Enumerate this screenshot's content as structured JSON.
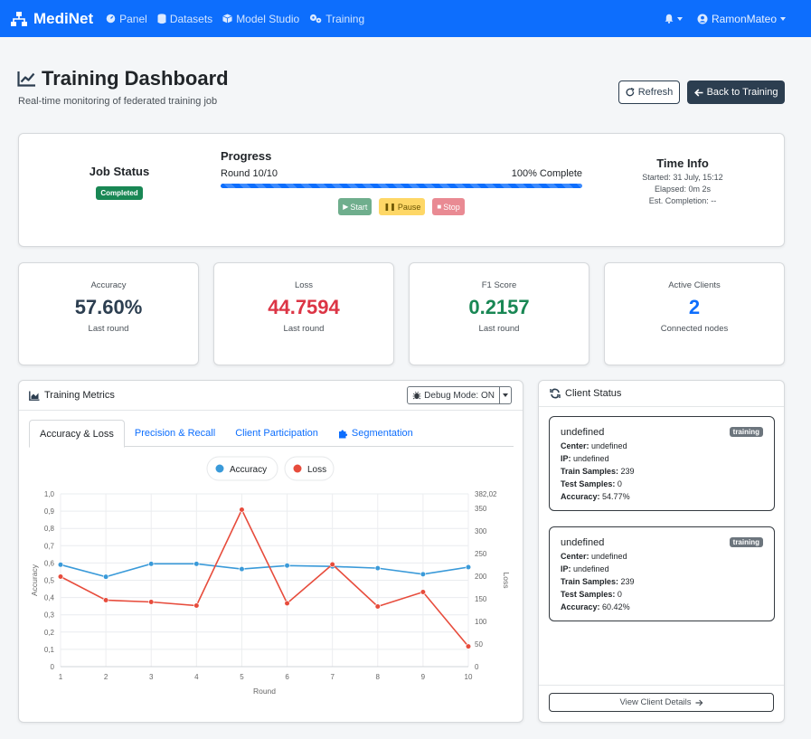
{
  "navbar": {
    "brand": "MediNet",
    "items": [
      {
        "label": "Panel",
        "icon": "dashboard-icon"
      },
      {
        "label": "Datasets",
        "icon": "database-icon"
      },
      {
        "label": "Model Studio",
        "icon": "cube-icon"
      },
      {
        "label": "Training",
        "icon": "gears-icon"
      }
    ],
    "user": "RamonMateo"
  },
  "header": {
    "title": "Training Dashboard",
    "subtitle": "Real-time monitoring of federated training job",
    "refresh_label": "Refresh",
    "back_label": "Back to Training"
  },
  "job": {
    "status_label": "Job Status",
    "status_badge": "Completed",
    "progress_title": "Progress",
    "round_text": "Round 10/10",
    "complete_text": "100% Complete",
    "progress_fraction": 1.0,
    "start_label": "Start",
    "pause_label": "Pause",
    "stop_label": "Stop",
    "time_title": "Time Info",
    "started": "Started: 31 July, 15:12",
    "elapsed": "Elapsed: 0m 2s",
    "est_completion": "Est. Completion: --"
  },
  "metrics": [
    {
      "label": "Accuracy",
      "value": "57.60%",
      "sub": "Last round",
      "color": "#2c3e50"
    },
    {
      "label": "Loss",
      "value": "44.7594",
      "sub": "Last round",
      "color": "#dc3545"
    },
    {
      "label": "F1 Score",
      "value": "0.2157",
      "sub": "Last round",
      "color": "#198754"
    },
    {
      "label": "Active Clients",
      "value": "2",
      "sub": "Connected nodes",
      "color": "#0d6efd"
    }
  ],
  "training_panel": {
    "title": "Training Metrics",
    "debug_label": "Debug Mode: ON",
    "tabs": [
      "Accuracy & Loss",
      "Precision & Recall",
      "Client Participation",
      "Segmentation"
    ]
  },
  "chart_data": {
    "type": "line",
    "x": [
      1,
      2,
      3,
      4,
      5,
      6,
      7,
      8,
      9,
      10
    ],
    "xlabel": "Round",
    "ylabel": "Accuracy",
    "y2label": "Loss",
    "ylim": [
      0,
      1
    ],
    "y2lim": [
      0,
      382.02
    ],
    "y_ticks": [
      "0",
      "0,1",
      "0,2",
      "0,3",
      "0,4",
      "0,5",
      "0,6",
      "0,7",
      "0,8",
      "0,9",
      "1,0"
    ],
    "y2_ticks": [
      "0",
      "50",
      "100",
      "150",
      "200",
      "250",
      "300",
      "350",
      "382,02"
    ],
    "series": [
      {
        "name": "Accuracy",
        "color": "#3a9ad9",
        "axis": "left",
        "values": [
          0.59,
          0.52,
          0.595,
          0.595,
          0.565,
          0.585,
          0.58,
          0.57,
          0.535,
          0.576
        ]
      },
      {
        "name": "Loss",
        "color": "#e74c3c",
        "axis": "right",
        "values": [
          199,
          147,
          143,
          135,
          347,
          140,
          226,
          133,
          165,
          44.76
        ]
      }
    ],
    "grid": true,
    "legend": "top"
  },
  "client_panel": {
    "title": "Client Status",
    "clients": [
      {
        "name": "undefined",
        "tag": "training",
        "center": "undefined",
        "ip": "undefined",
        "train_samples": "239",
        "test_samples": "0",
        "accuracy": "54.77%"
      },
      {
        "name": "undefined",
        "tag": "training",
        "center": "undefined",
        "ip": "undefined",
        "train_samples": "239",
        "test_samples": "0",
        "accuracy": "60.42%"
      }
    ],
    "labels": {
      "center": "Center:",
      "ip": "IP:",
      "train": "Train Samples:",
      "test": "Test Samples:",
      "accuracy": "Accuracy:"
    },
    "view_details": "View Client Details"
  }
}
